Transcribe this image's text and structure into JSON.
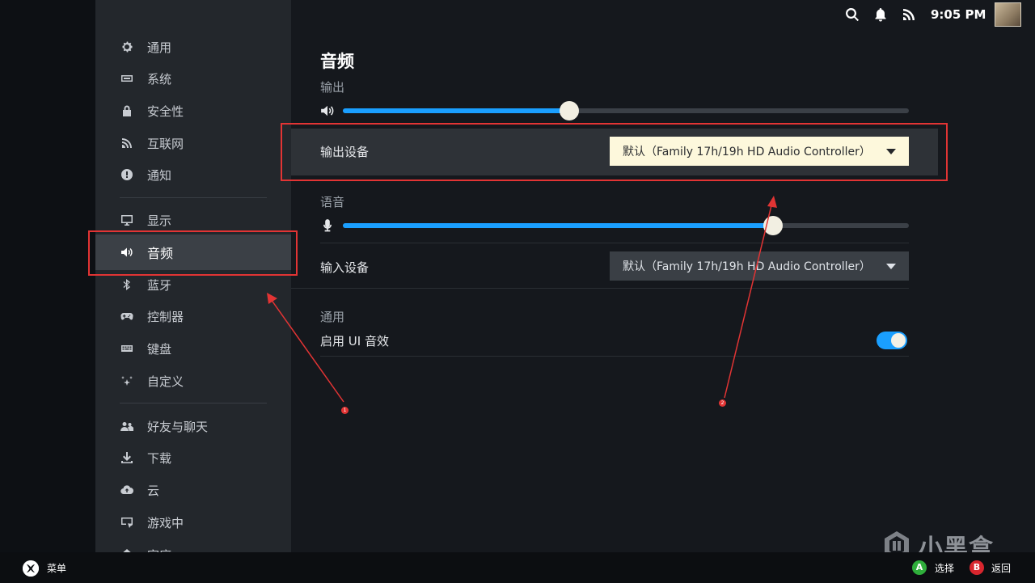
{
  "sidebar": {
    "items": [
      {
        "label": "通用",
        "icon": "gear-icon"
      },
      {
        "label": "系统",
        "icon": "system-icon"
      },
      {
        "label": "安全性",
        "icon": "lock-icon"
      },
      {
        "label": "互联网",
        "icon": "wifi-icon"
      },
      {
        "label": "通知",
        "icon": "alert-icon"
      },
      {
        "label": "显示",
        "icon": "monitor-icon"
      },
      {
        "label": "音频",
        "icon": "speaker-icon",
        "active": true
      },
      {
        "label": "蓝牙",
        "icon": "bluetooth-icon"
      },
      {
        "label": "控制器",
        "icon": "gamepad-icon"
      },
      {
        "label": "键盘",
        "icon": "keyboard-icon"
      },
      {
        "label": "自定义",
        "icon": "sparkle-icon"
      },
      {
        "label": "好友与聊天",
        "icon": "friends-icon"
      },
      {
        "label": "下载",
        "icon": "download-icon"
      },
      {
        "label": "云",
        "icon": "cloud-icon"
      },
      {
        "label": "游戏中",
        "icon": "in-game-icon"
      },
      {
        "label": "家庭",
        "icon": "home-icon"
      }
    ]
  },
  "topbar": {
    "time": "9:05 PM",
    "icons": [
      "search-icon",
      "bell-icon",
      "signal-icon"
    ]
  },
  "audio": {
    "title": "音频",
    "output": {
      "label": "输出",
      "volume": 0.4
    },
    "output_device": {
      "label": "输出设备",
      "value": "默认（Family 17h/19h HD Audio Controller）"
    },
    "voice": {
      "label": "语音",
      "volume": 0.76
    },
    "input_device": {
      "label": "输入设备",
      "value": "默认（Family 17h/19h HD Audio Controller）"
    },
    "general": {
      "label": "通用"
    },
    "ui_sounds": {
      "label": "启用 UI 音效",
      "enabled": true
    }
  },
  "annotations": {
    "marker_1": "1",
    "marker_2": "2"
  },
  "bottombar": {
    "menu_label": "菜单",
    "a_button": "A",
    "select_label": "选择",
    "b_button": "B",
    "back_label": "返回"
  },
  "watermark": {
    "text": "小黑盒"
  },
  "colors": {
    "accent": "#1a9fff",
    "highlight": "#e23434",
    "focus": "#fdf8dc"
  }
}
